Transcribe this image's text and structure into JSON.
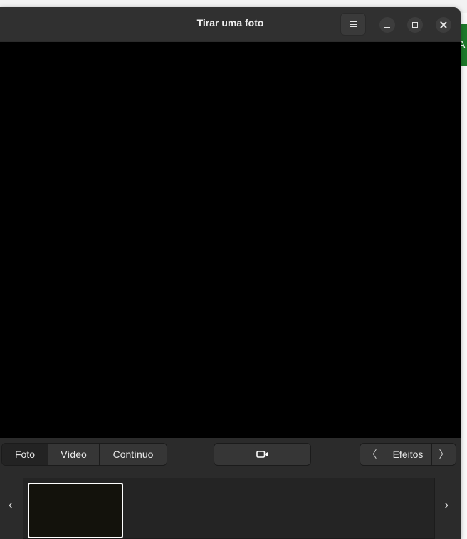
{
  "window": {
    "title": "Tirar uma foto"
  },
  "background": {
    "partial_glyph": "A"
  },
  "titlebar_buttons": {
    "menu_icon": "hamburger-icon",
    "minimize_icon": "minimize-icon",
    "maximize_icon": "maximize-icon",
    "close_icon": "close-icon"
  },
  "modes": [
    {
      "label": "Foto",
      "active": true
    },
    {
      "label": "Vídeo",
      "active": false
    },
    {
      "label": "Contínuo",
      "active": false
    }
  ],
  "capture": {
    "icon": "video-camera-icon"
  },
  "effects": {
    "label": "Efeitos",
    "prev_glyph": "〈",
    "next_glyph": "〉"
  },
  "strip": {
    "prev_glyph": "‹",
    "next_glyph": "›"
  },
  "colors": {
    "window_bg": "#2b2b2b",
    "preview_bg": "#000000",
    "accent_green": "#1d7a2a",
    "thumb_border": "#ffffff"
  }
}
